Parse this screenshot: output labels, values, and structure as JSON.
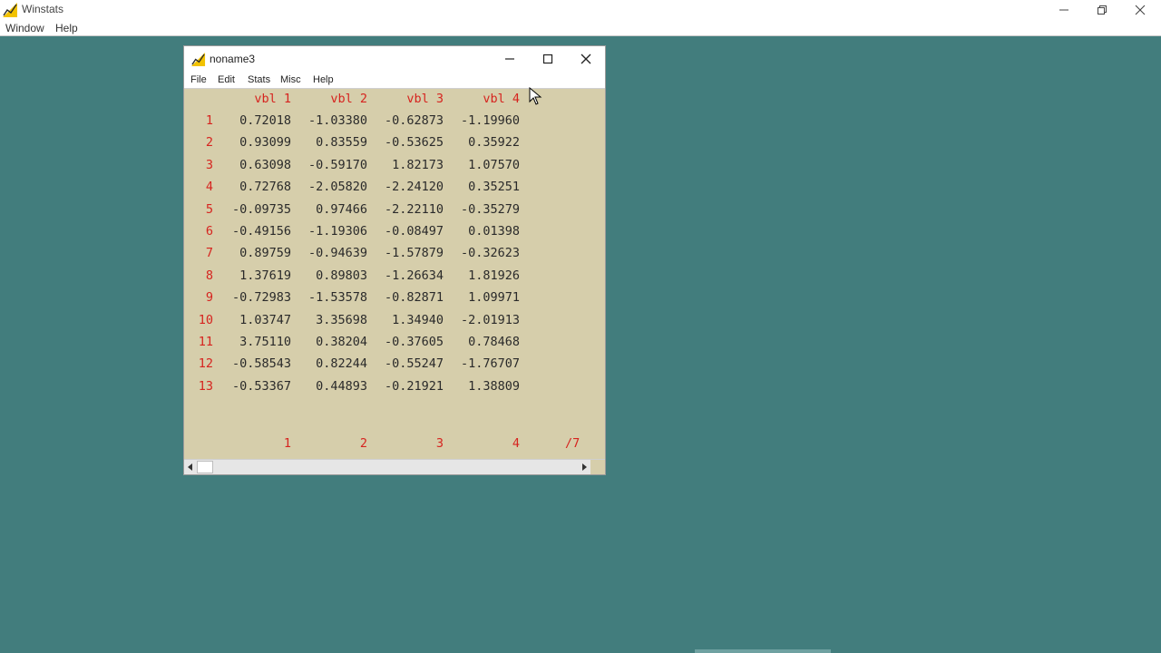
{
  "app": {
    "title": "Winstats",
    "menu": [
      "Window",
      "Help"
    ]
  },
  "child": {
    "title": "noname3",
    "menu": [
      "File",
      "Edit",
      "Stats",
      "Misc",
      "Help"
    ]
  },
  "grid": {
    "headers": [
      "vbl 1",
      "vbl 2",
      "vbl 3",
      "vbl 4"
    ],
    "rows": [
      {
        "n": "1",
        "v": [
          "0.72018",
          "-1.03380",
          "-0.62873",
          "-1.19960"
        ]
      },
      {
        "n": "2",
        "v": [
          "0.93099",
          "0.83559",
          "-0.53625",
          "0.35922"
        ]
      },
      {
        "n": "3",
        "v": [
          "0.63098",
          "-0.59170",
          "1.82173",
          "1.07570"
        ]
      },
      {
        "n": "4",
        "v": [
          "0.72768",
          "-2.05820",
          "-2.24120",
          "0.35251"
        ]
      },
      {
        "n": "5",
        "v": [
          "-0.09735",
          "0.97466",
          "-2.22110",
          "-0.35279"
        ]
      },
      {
        "n": "6",
        "v": [
          "-0.49156",
          "-1.19306",
          "-0.08497",
          "0.01398"
        ]
      },
      {
        "n": "7",
        "v": [
          "0.89759",
          "-0.94639",
          "-1.57879",
          "-0.32623"
        ]
      },
      {
        "n": "8",
        "v": [
          "1.37619",
          "0.89803",
          "-1.26634",
          "1.81926"
        ]
      },
      {
        "n": "9",
        "v": [
          "-0.72983",
          "-1.53578",
          "-0.82871",
          "1.09971"
        ]
      },
      {
        "n": "10",
        "v": [
          "1.03747",
          "3.35698",
          "1.34940",
          "-2.01913"
        ]
      },
      {
        "n": "11",
        "v": [
          "3.75110",
          "0.38204",
          "-0.37605",
          "0.78468"
        ]
      },
      {
        "n": "12",
        "v": [
          "-0.58543",
          "0.82244",
          "-0.55247",
          "-1.76707"
        ]
      },
      {
        "n": "13",
        "v": [
          "-0.53367",
          "0.44893",
          "-0.21921",
          "1.38809"
        ]
      }
    ],
    "col_index": [
      "1",
      "2",
      "3",
      "4"
    ],
    "col_total": "/7"
  },
  "colors": {
    "desktop": "#427d7d",
    "window_body": "#d6ceab",
    "accent_red": "#d6241f"
  },
  "icons": {
    "app_logo": "winstats-logo-icon",
    "child_logo": "winstats-logo-icon",
    "cursor": "mouse-pointer-icon"
  }
}
